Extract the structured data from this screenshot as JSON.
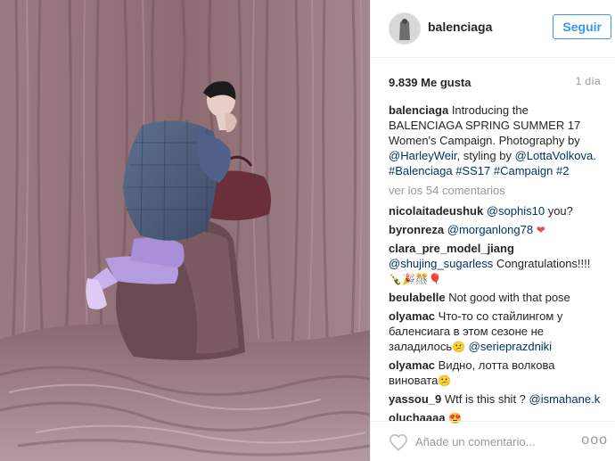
{
  "post": {
    "username": "balenciaga",
    "follow_label": "Seguir",
    "likes": "9.839 Me gusta",
    "time": "1 día"
  },
  "caption": {
    "username": "balenciaga",
    "text_1": " Introducing the BALENCIAGA SPRING SUMMER 17 Women's Campaign. Photography by ",
    "tag_1": "@HarleyWeir",
    "text_2": ", styling by ",
    "tag_2": "@LottaVolkova",
    "text_3": ". ",
    "tag_3": "#Balenciaga",
    "tag_4": "#SS17",
    "tag_5": "#Campaign",
    "tag_6": "#2"
  },
  "view_more": "ver los 54 comentarios",
  "comments": [
    {
      "username": "nicolaitadeushuk",
      "mention": "@sophis10",
      "text": " you?"
    },
    {
      "username": "byronreza",
      "mention": "@morganlong78",
      "emoji": "❤"
    },
    {
      "username": "clara_pre_model_jiang",
      "mention": "@shujing_sugarless",
      "text": " Congratulations!!!!",
      "emoji": "🍾🎉🎊🎈"
    },
    {
      "username": "beulabelle",
      "text": " Not good with that pose"
    },
    {
      "username": "olyamac",
      "text": " Что-то со стайлингом у баленсиага в этом сезоне не заладилось",
      "emoji_mid": "😕",
      "mention": "@serieprazdniki"
    },
    {
      "username": "olyamac",
      "text": " Видно, лотта волкова виновата",
      "emoji": "😕"
    },
    {
      "username": "yassou_9",
      "text": " Wtf is this shit ? ",
      "mention": "@ismahane.k"
    },
    {
      "username": "oluchaaaa",
      "emoji": "😍"
    }
  ],
  "footer": {
    "placeholder": "Añade un comentario...",
    "options": "ooo"
  },
  "icons": [
    "heart-icon",
    "more-options-icon"
  ],
  "colors": {
    "link": "#003569",
    "accent": "#3897f0",
    "muted": "#999999",
    "heart_red": "#ed4956"
  }
}
